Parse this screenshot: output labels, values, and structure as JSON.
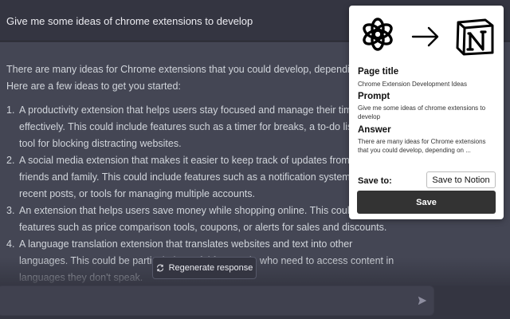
{
  "conversation": {
    "prompt": "Give me some ideas of chrome extensions to develop",
    "answer_intro": "There are many ideas for Chrome extensions that you could develop, depending on your interests and skills. Here are a few ideas to get you started:",
    "items": [
      {
        "number": "1.",
        "text": "A productivity extension that helps users stay focused and manage their time more effectively. This could include features such as a timer for breaks, a to-do list, or a tool for blocking distracting websites."
      },
      {
        "number": "2.",
        "text": "A social media extension that makes it easier to keep track of updates from your friends and family. This could include features such as a notification system, a feed of recent posts, or tools for managing multiple accounts."
      },
      {
        "number": "3.",
        "text": "An extension that helps users save money while shopping online. This could include features such as price comparison tools, coupons, or alerts for sales and discounts."
      },
      {
        "number": "4.",
        "text": "A language translation extension that translates websites and text into other languages. This could be particularly useful for people who need to access content in languages they don't speak."
      }
    ],
    "regenerate_label": "Regenerate response"
  },
  "popup": {
    "page_title_label": "Page title",
    "page_title_value": "Chrome Extension Development Ideas",
    "prompt_label": "Prompt",
    "prompt_value": "Give me some ideas of chrome extensions to develop",
    "answer_label": "Answer",
    "answer_value": "There are many ideas for Chrome extensions that you could develop, depending on ...",
    "save_to_label": "Save to:",
    "save_to_value": "Save to Notion",
    "save_label": "Save"
  },
  "icons": {
    "openai": "openai-logo-icon",
    "arrow": "arrow-right-icon",
    "notion": "notion-logo-icon",
    "regenerate": "refresh-icon",
    "send": "send-icon"
  },
  "colors": {
    "background": "#343541",
    "answer_background": "#444654",
    "popup_background": "#ffffff",
    "save_button": "#333333"
  }
}
